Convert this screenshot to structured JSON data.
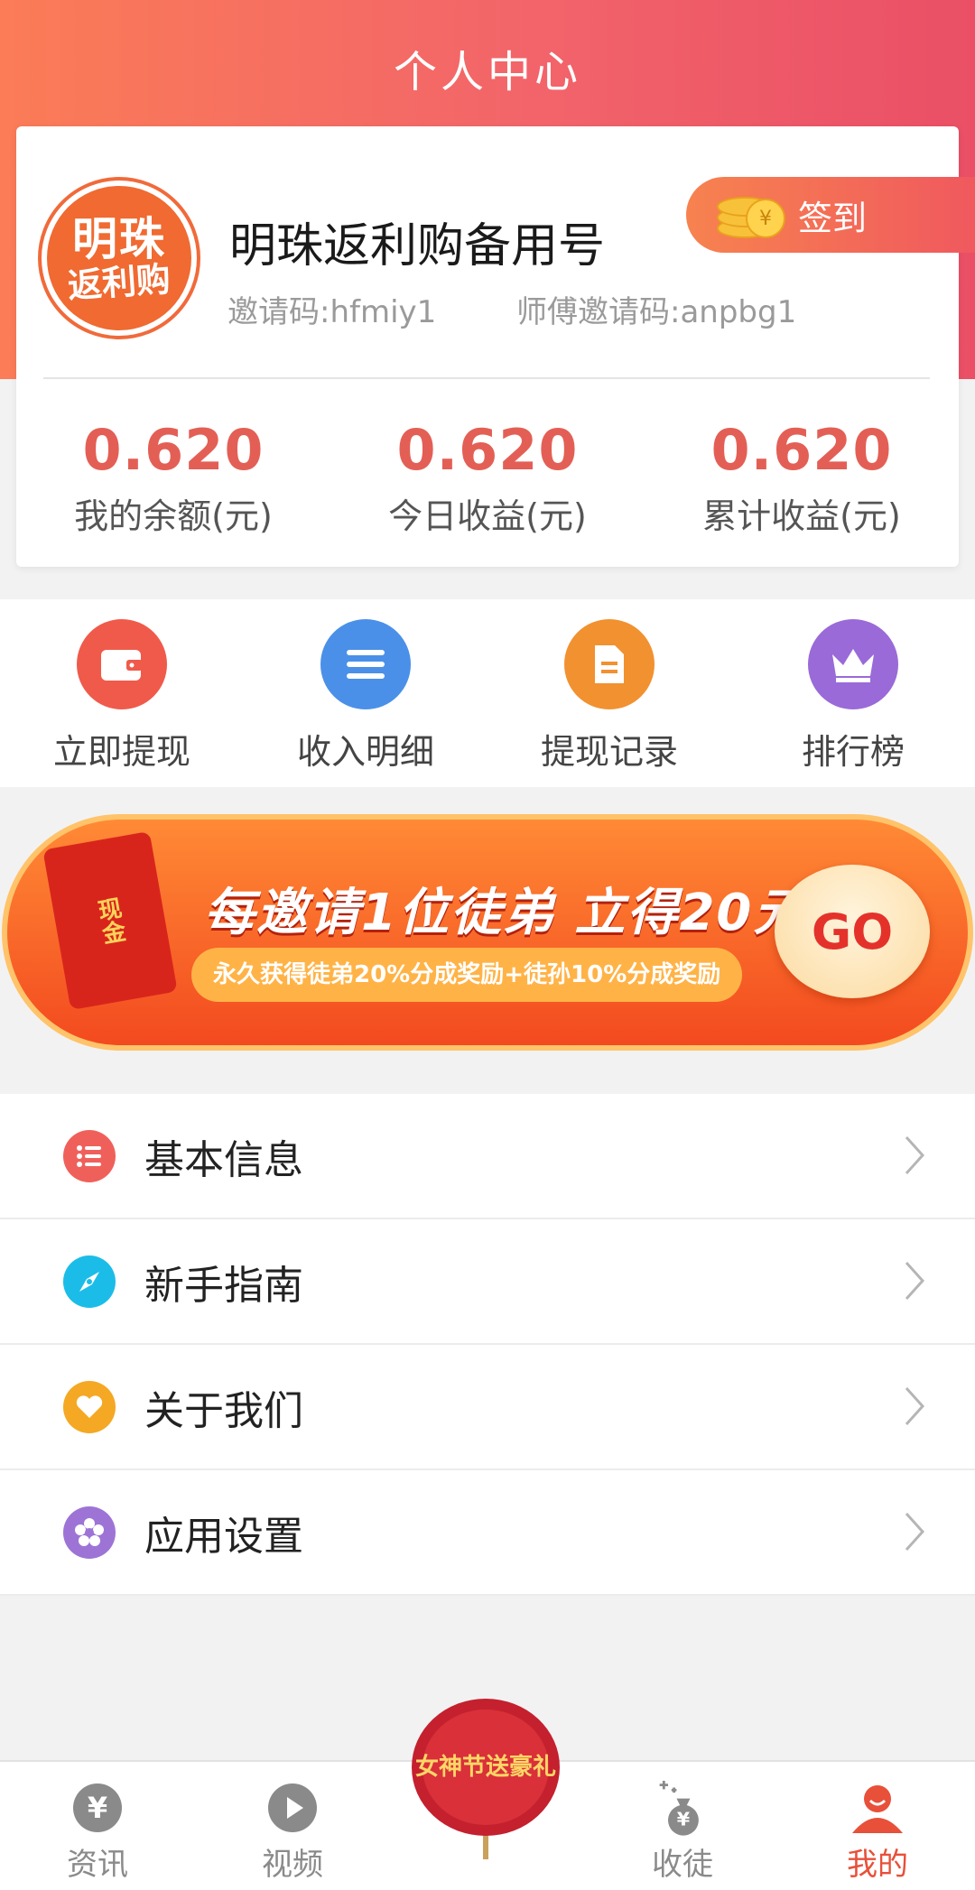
{
  "header": {
    "title": "个人中心"
  },
  "profile": {
    "avatar_line1": "明珠",
    "avatar_line2": "返利购",
    "name": "明珠返利购备用号",
    "invite_code": "邀请码:hfmiy1",
    "master_invite_code": "师傅邀请码:anpbg1",
    "checkin_label": "签到",
    "checkin_icon": "coin-icon"
  },
  "stats": [
    {
      "value": "0.620",
      "label": "我的余额(元)"
    },
    {
      "value": "0.620",
      "label": "今日收益(元)"
    },
    {
      "value": "0.620",
      "label": "累计收益(元)"
    }
  ],
  "actions": [
    {
      "label": "立即提现",
      "icon": "wallet-icon",
      "color": "#f05a4a"
    },
    {
      "label": "收入明细",
      "icon": "list-icon",
      "color": "#4a90e8"
    },
    {
      "label": "提现记录",
      "icon": "document-icon",
      "color": "#f29130"
    },
    {
      "label": "排行榜",
      "icon": "crown-icon",
      "color": "#9a6ad8"
    }
  ],
  "banner": {
    "headline": "每邀请1位徒弟 立得20元",
    "subline": "永久获得徒弟20%分成奖励+徒孙10%分成奖励",
    "envelope_text": "现金",
    "go_label": "GO"
  },
  "menu": [
    {
      "label": "基本信息",
      "icon": "list-icon",
      "color": "#f0605a"
    },
    {
      "label": "新手指南",
      "icon": "compass-icon",
      "color": "#1bbde8"
    },
    {
      "label": "关于我们",
      "icon": "heart-icon",
      "color": "#f5a823"
    },
    {
      "label": "应用设置",
      "icon": "settings-icon",
      "color": "#9d74d6"
    }
  ],
  "tabbar": [
    {
      "label": "资讯",
      "icon": "yuan-icon"
    },
    {
      "label": "视频",
      "icon": "play-icon"
    },
    {
      "label": "",
      "icon": "promo-balloon-icon"
    },
    {
      "label": "收徒",
      "icon": "money-bag-icon"
    },
    {
      "label": "我的",
      "icon": "user-icon",
      "active": true
    }
  ],
  "promo": {
    "text": "女神节送豪礼"
  }
}
